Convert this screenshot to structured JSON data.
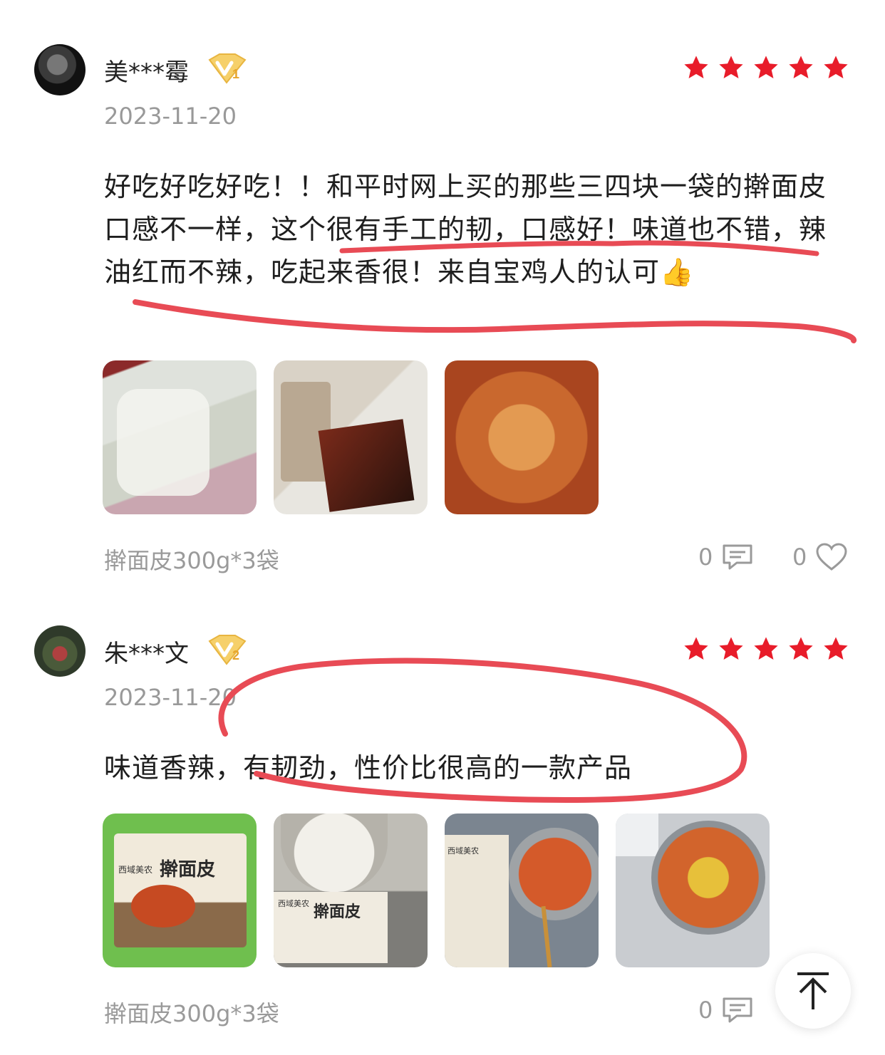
{
  "reviews": [
    {
      "username": "美***霉",
      "vip_level": "1",
      "rating": 5,
      "date": "2023-11-20",
      "text": "好吃好吃好吃！！和平时网上买的那些三四块一袋的擀面皮口感不一样，这个很有手工的韧，口感好！味道也不错，辣油红而不辣，吃起来香很！来自宝鸡人的认可👍",
      "photos": [
        "dough-sheets-photo",
        "seasoning-packets-photo",
        "mixed-noodles-photo"
      ],
      "sku": "擀面皮300g*3袋",
      "comments": "0",
      "likes": "0"
    },
    {
      "username": "朱***文",
      "vip_level": "2",
      "rating": 5,
      "date": "2023-11-20",
      "text": "味道香辣，有韧劲，性价比很高的一款产品",
      "photos": [
        "package-photo",
        "package-and-noodles-photo",
        "bowl-with-package-photo",
        "bowl-noodles-photo"
      ],
      "package_text": [
        "西域美农",
        "擀面皮"
      ],
      "sku": "擀面皮300g*3袋",
      "comments": "0"
    }
  ],
  "colors": {
    "star": "#e81c2a",
    "annotation": "#e84b55",
    "vip_gold": "#f3c04a"
  }
}
